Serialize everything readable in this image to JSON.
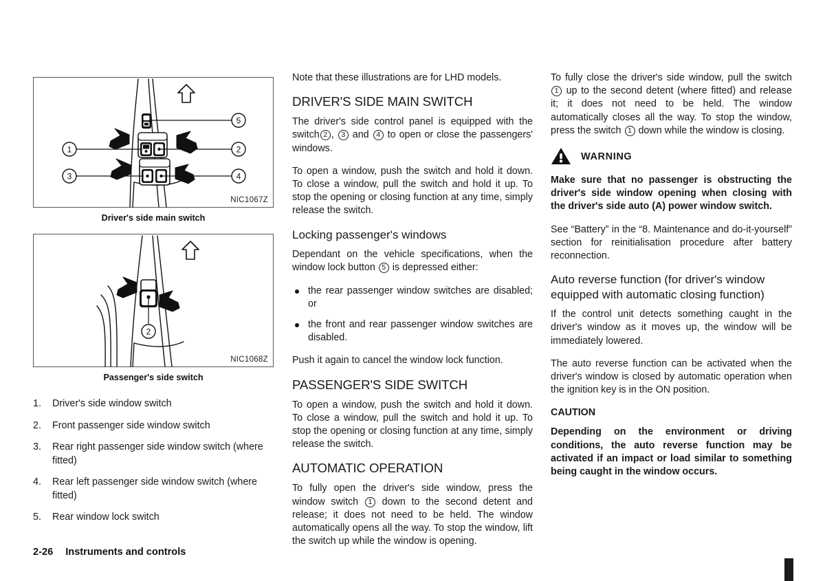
{
  "document": {
    "footer": {
      "page_number": "2-26",
      "section_title": "Instruments and controls"
    }
  },
  "figures": [
    {
      "id": "fig-drivers-side-main-switch",
      "code": "NIC1067Z",
      "caption": "Driver's side main switch",
      "callouts": [
        "1",
        "2",
        "3",
        "4",
        "5"
      ]
    },
    {
      "id": "fig-passengers-side-switch",
      "code": "NIC1068Z",
      "caption": "Passenger's side switch",
      "callouts": [
        "2"
      ]
    }
  ],
  "left_column": {
    "numbered_list": [
      {
        "number": "1.",
        "text": "Driver's side window switch"
      },
      {
        "number": "2.",
        "text": "Front passenger side window switch"
      },
      {
        "number": "3.",
        "text": "Rear right passenger side window switch (where fitted)"
      },
      {
        "number": "4.",
        "text": "Rear left passenger side window switch (where fitted)"
      },
      {
        "number": "5.",
        "text": "Rear window lock switch"
      }
    ]
  },
  "middle_column": {
    "note": "Note that these illustrations are for LHD models.",
    "heading_drivers_main": "DRIVER'S SIDE MAIN SWITCH",
    "para_panel_equipped_a": "The driver's side control panel is equipped with the switch",
    "ref2": "2",
    "para_panel_equipped_b": ",",
    "ref3": "3",
    "para_panel_equipped_c": "and",
    "ref4": "4",
    "para_panel_equipped_d": "to open or close the passengers' windows.",
    "para_open_close_1": "To open a window, push the switch and hold it down. To close a window, pull the switch and hold it up. To stop the opening or closing function at any time, simply release the switch.",
    "subheading_locking": "Locking passenger's windows",
    "para_dependant_a": "Dependant on the vehicle specifications, when the window lock button",
    "ref5": "5",
    "para_dependant_b": "is depressed either:",
    "bullets": [
      "the rear passenger window switches are disabled; or",
      "the front and rear passenger window switches are disabled."
    ],
    "para_push_again": "Push it again to cancel the window lock function.",
    "heading_passengers_side": "PASSENGER'S SIDE SWITCH",
    "para_open_close_2": "To open a window, push the switch and hold it down. To close a window, pull the switch and hold it up. To stop the opening or closing function at any time, simply release the switch.",
    "heading_automatic": "AUTOMATIC OPERATION",
    "para_fully_open_a": "To fully open the driver's side window, press the window switch",
    "ref1": "1",
    "para_fully_open_b": "down to the second detent and release; it does not need to be held. The window automatically opens all the way. To stop the window, lift the switch up while the window is opening."
  },
  "right_column": {
    "para_fully_close_a": "To fully close the driver's side window, pull the switch",
    "ref1a": "1",
    "para_fully_close_b": "up to the second detent (where fitted) and release it; it does not need to be held. The window automatically closes all the way. To stop the window, press the switch",
    "ref1b": "1",
    "para_fully_close_c": "down while the window is closing.",
    "warning_label": "WARNING",
    "warning_text": "Make sure that no passenger is obstructing the driver's side window opening when closing with the driver's side auto (A) power window switch.",
    "para_see_battery": "See “Battery” in the “8. Maintenance and do-it-yourself” section for reinitialisation procedure after battery reconnection.",
    "subheading_auto_reverse": "Auto reverse function (for driver's window equipped with automatic closing function)",
    "para_control_unit": "If the control unit detects something caught in the driver's window as it moves up, the window will be immediately lowered.",
    "para_auto_reverse_activated": "The auto reverse function can be activated when the driver's window is closed by automatic operation when the ignition key is in the ON position.",
    "caution_label": "CAUTION",
    "caution_text": "Depending on the environment or driving conditions, the auto reverse function may be activated if an impact or load similar to something being caught in the window occurs."
  },
  "colors": {
    "text": "#1a1a1a",
    "figure_border": "#555555",
    "edge_tab": "#1b1b1b"
  }
}
